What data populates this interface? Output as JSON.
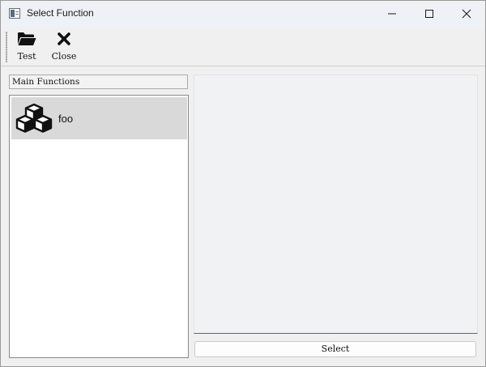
{
  "window": {
    "title": "Select Function"
  },
  "toolbar": {
    "test_label": "Test",
    "close_label": "Close"
  },
  "left_panel": {
    "header": "Main Functions",
    "items": [
      {
        "label": "foo",
        "icon": "cubes-icon"
      }
    ]
  },
  "right_panel": {
    "select_label": "Select"
  },
  "colors": {
    "selection_bg": "#d9d9d9",
    "focus_underline": "#2a6fc7",
    "titlebar_bg": "#eef1f6"
  }
}
